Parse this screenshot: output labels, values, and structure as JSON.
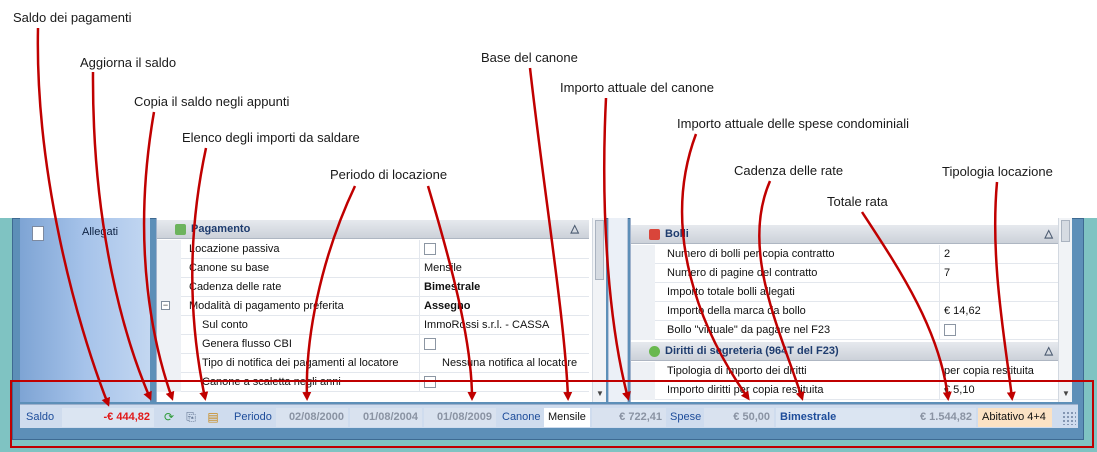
{
  "annotations": {
    "saldo": "Saldo dei pagamenti",
    "aggiorna": "Aggiorna il saldo",
    "copia": "Copia il saldo negli appunti",
    "elenco": "Elenco degli importi da saldare",
    "periodo": "Periodo di locazione",
    "base": "Base del canone",
    "importo_canone": "Importo attuale del canone",
    "importo_spese": "Importo attuale delle spese condominiali",
    "cadenza": "Cadenza delle rate",
    "totale": "Totale rata",
    "tipologia": "Tipologia locazione"
  },
  "sidebar": {
    "item_label": "Allegati"
  },
  "left_panel": {
    "group_title": "Pagamento",
    "rows": [
      {
        "label": "Locazione passiva",
        "value": ""
      },
      {
        "label": "Canone su base",
        "value": "Mensile"
      },
      {
        "label": "Cadenza delle rate",
        "value": "Bimestrale"
      },
      {
        "label": "Modalità di pagamento preferita",
        "value": "Assegno"
      },
      {
        "label": "Sul conto",
        "value": "ImmoRossi s.r.l. - CASSA"
      },
      {
        "label": "Genera flusso CBI",
        "value": ""
      },
      {
        "label": "Tipo di notifica dei pagamenti al locatore",
        "value": "Nessuna notifica al locatore"
      },
      {
        "label": "Canone a scaletta negli anni",
        "value": ""
      }
    ]
  },
  "right_panel": {
    "group1_title": "Bolli",
    "group1_rows": [
      {
        "label": "Numero di bolli per copia contratto",
        "value": "2"
      },
      {
        "label": "Numero di pagine del contratto",
        "value": "7"
      },
      {
        "label": "Importo totale bolli allegati",
        "value": ""
      },
      {
        "label": "Importo della marca da bollo",
        "value": "€ 14,62"
      },
      {
        "label": "Bollo \"virtuale\" da pagare nel F23",
        "value": ""
      }
    ],
    "group2_title": "Diritti di segreteria (964T del F23)",
    "group2_rows": [
      {
        "label": "Tipologia di importo dei diritti",
        "value": "per copia restituita"
      },
      {
        "label": "Importo diritti per copia restituita",
        "value": "€ 5,10"
      }
    ]
  },
  "status_bar": {
    "saldo_label": "Saldo",
    "saldo_value": "-€ 444,82",
    "periodo_label": "Periodo",
    "period_start": "02/08/2000",
    "period_mid": "01/08/2004",
    "period_end": "01/08/2009",
    "canone_label": "Canone",
    "canone_base": "Mensile",
    "canone_value": "€ 722,41",
    "spese_label": "Spese",
    "spese_value": "€ 50,00",
    "cadenza": "Bimestrale",
    "totale": "€ 1.544,82",
    "tipologia": "Abitativo 4+4"
  },
  "colors": {
    "annotation_arrow": "#c00000",
    "saldo_negative": "#e11818",
    "status_label": "#1d4c9a",
    "tipologia_bg": "#fbe2c4"
  },
  "icons": {
    "refresh": "refresh-icon",
    "copy": "copy-icon",
    "list": "payments-list-icon",
    "attachment": "document-icon",
    "resize": "resize-grip-icon"
  }
}
